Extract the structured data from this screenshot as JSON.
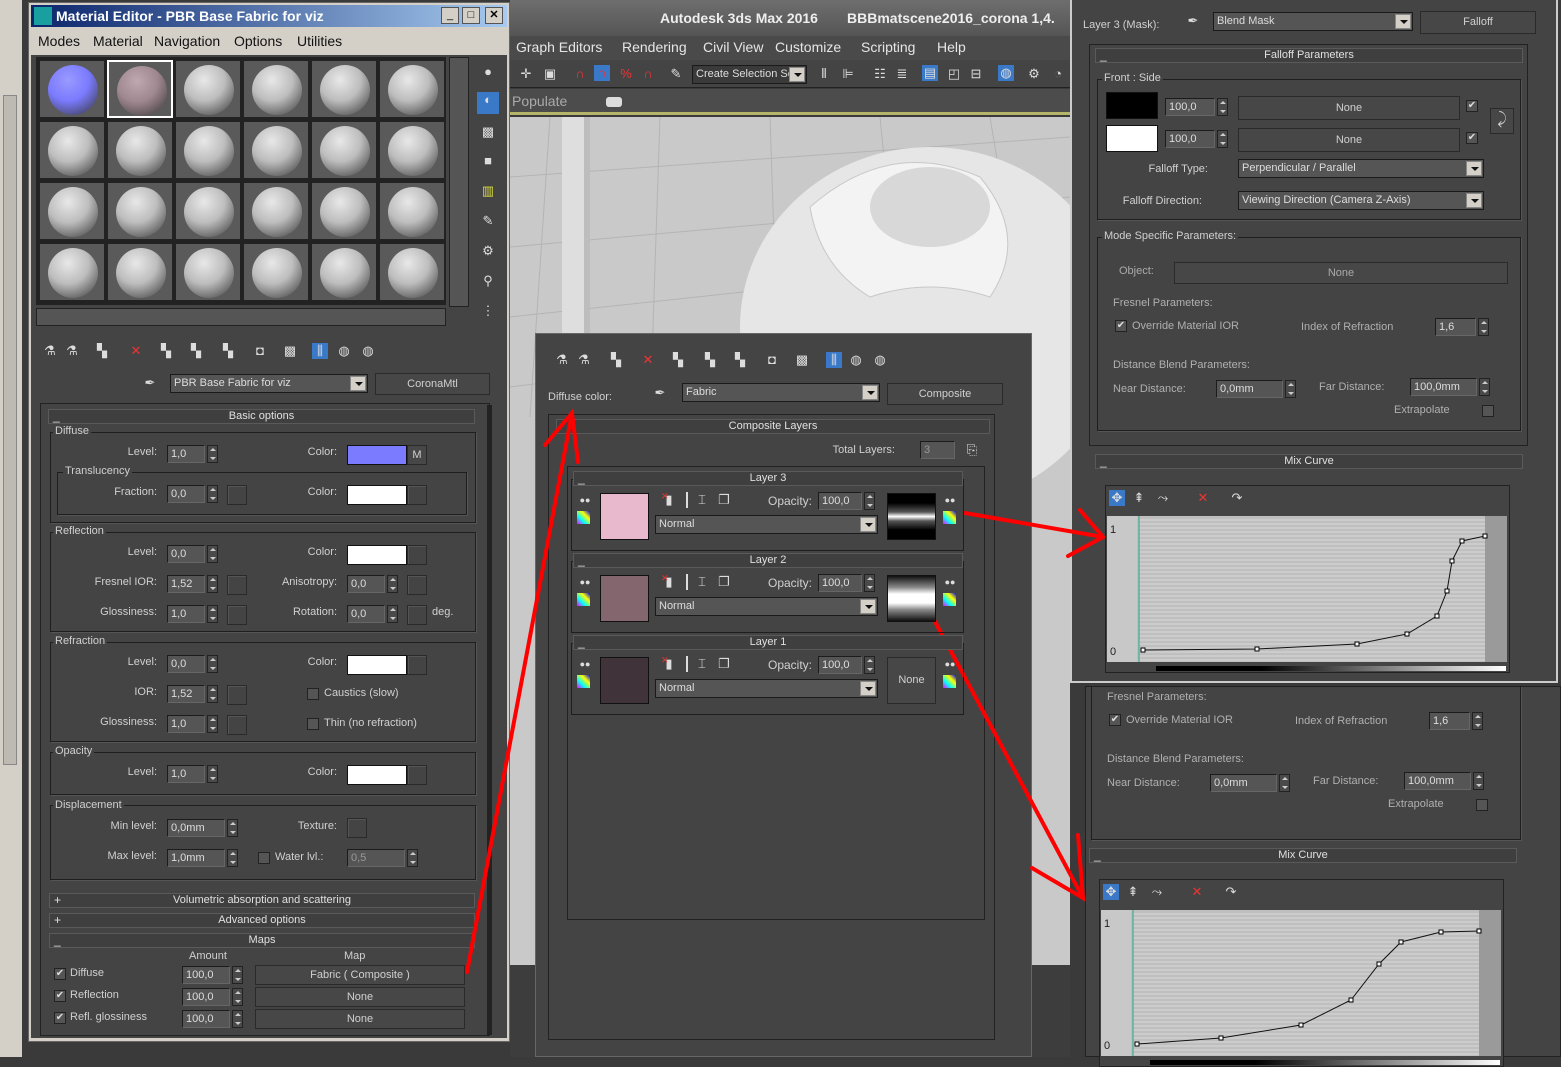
{
  "mat_editor": {
    "title": "Material Editor - PBR Base Fabric for viz",
    "menu": [
      "Modes",
      "Material",
      "Navigation",
      "Options",
      "Utilities"
    ],
    "material_name": "PBR Base Fabric for viz",
    "material_type": "CoronaMtl",
    "basic": {
      "title": "Basic options",
      "level_label": "Level:",
      "color_label": "Color:",
      "glossiness_label": "Glossiness:",
      "diffuse": {
        "label": "Diffuse",
        "level": "1,0",
        "color": "#7b7bff",
        "map_button": "M"
      },
      "translucency": {
        "label": "Translucency",
        "fraction_label": "Fraction:",
        "fraction": "0,0",
        "color": "#ffffff"
      },
      "reflection": {
        "label": "Reflection",
        "level": "0,0",
        "color": "#ffffff",
        "fresnel_label": "Fresnel IOR:",
        "fresnel": "1,52",
        "anisotropy_label": "Anisotropy:",
        "anisotropy": "0,0",
        "glossiness": "1,0",
        "rotation_label": "Rotation:",
        "rotation": "0,0",
        "deg": "deg."
      },
      "refraction": {
        "label": "Refraction",
        "level": "0,0",
        "color": "#ffffff",
        "ior_label": "IOR:",
        "ior": "1,52",
        "glossiness": "1,0",
        "caustics": "Caustics (slow)",
        "thin": "Thin (no refraction)"
      },
      "opacity": {
        "label": "Opacity",
        "level": "1,0",
        "color": "#ffffff"
      },
      "displacement": {
        "label": "Displacement",
        "min_label": "Min level:",
        "min": "0,0mm",
        "max_label": "Max level:",
        "max": "1,0mm",
        "texture_label": "Texture:",
        "water_label": "Water lvl.:",
        "water": "0,5"
      }
    },
    "rollouts": {
      "volumetric": "Volumetric absorption and scattering",
      "advanced": "Advanced options"
    },
    "maps": {
      "title": "Maps",
      "amount_header": "Amount",
      "map_header": "Map",
      "rows": [
        {
          "name": "Diffuse",
          "amount": "100,0",
          "map": "Fabric  ( Composite )",
          "checked": true
        },
        {
          "name": "Reflection",
          "amount": "100,0",
          "map": "None",
          "checked": true
        },
        {
          "name": "Refl. glossiness",
          "amount": "100,0",
          "map": "None",
          "checked": true
        }
      ]
    }
  },
  "max": {
    "app_title": "Autodesk 3ds Max 2016",
    "file_title": "BBBmatscene2016_corona 1,4.",
    "menu": [
      "Graph Editors",
      "Rendering",
      "Civil View",
      "Customize",
      "Scripting",
      "Help"
    ],
    "selection_set": "Create Selection Se",
    "populate": "Populate"
  },
  "composite": {
    "slot_label": "Diffuse color:",
    "name": "Fabric",
    "type": "Composite",
    "rollout": "Composite Layers",
    "total_label": "Total Layers:",
    "total": "3",
    "opacity_label": "Opacity:",
    "layers": [
      {
        "title": "Layer 3",
        "opacity": "100,0",
        "blend": "Normal",
        "color": "#e8b9cc",
        "mask": "falloff-band"
      },
      {
        "title": "Layer 2",
        "opacity": "100,0",
        "blend": "Normal",
        "color": "#84666f",
        "mask": "falloff-wide"
      },
      {
        "title": "Layer 1",
        "opacity": "100,0",
        "blend": "Normal",
        "color": "#40343a",
        "mask": "None"
      }
    ]
  },
  "falloff": {
    "slot_label": "Layer 3 (Mask):",
    "name": "Blend Mask",
    "type": "Falloff",
    "params_title": "Falloff Parameters",
    "front_side": "Front : Side",
    "rows": [
      {
        "color": "#000000",
        "value": "100,0",
        "map": "None",
        "checked": true
      },
      {
        "color": "#ffffff",
        "value": "100,0",
        "map": "None",
        "checked": true
      }
    ],
    "type_label": "Falloff Type:",
    "type_value": "Perpendicular / Parallel",
    "direction_label": "Falloff Direction:",
    "direction_value": "Viewing Direction (Camera Z-Axis)",
    "mode_label": "Mode Specific Parameters:",
    "object_label": "Object:",
    "object": "None",
    "fresnel_label": "Fresnel Parameters:",
    "override": "Override Material IOR",
    "ior_label": "Index of Refraction",
    "ior": "1,6",
    "distance_label": "Distance Blend Parameters:",
    "near_label": "Near Distance:",
    "near": "0,0mm",
    "far_label": "Far Distance:",
    "far": "100,0mm",
    "extrapolate": "Extrapolate",
    "curve_title": "Mix Curve",
    "curve_y_max": "1",
    "curve_y_min": "0"
  },
  "colors": {
    "annotation_arrow": "#ff0000",
    "accent_blue": "#3a78c8"
  }
}
